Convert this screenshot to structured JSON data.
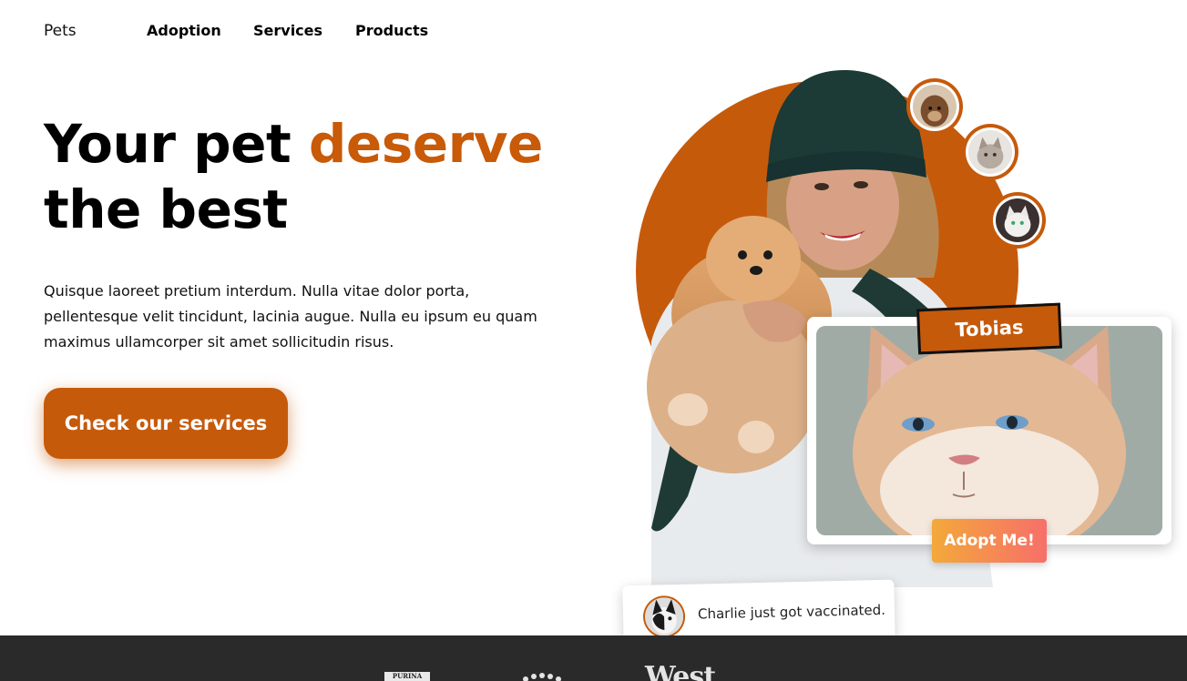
{
  "nav": {
    "brand": "Pets",
    "links": [
      "Adoption",
      "Services",
      "Products"
    ]
  },
  "hero": {
    "title_part1": "Your pet ",
    "title_accent": "deserve",
    "title_part2": "the best",
    "description": "Quisque laoreet pretium interdum. Nulla vitae dolor porta, pellentesque velit tincidunt, lacinia augue. Nulla eu ipsum eu quam maximus ullamcorper sit amet sollicitudin risus.",
    "cta_label": "Check our services"
  },
  "pet_card": {
    "name": "Tobias",
    "adopt_label": "Adopt Me!"
  },
  "toast": {
    "message": "Charlie just got vaccinated."
  },
  "footer_brands": {
    "purina": "PURINA",
    "west": "West"
  },
  "colors": {
    "accent": "#c65a0b",
    "footer_bg": "#2a2a2a",
    "adopt_gradient_start": "#f3a93a",
    "adopt_gradient_end": "#f76f6a"
  },
  "icons": [
    "dog-avatar-icon",
    "cat-avatar-icon",
    "white-cat-avatar-icon",
    "dog-toast-avatar-icon"
  ]
}
